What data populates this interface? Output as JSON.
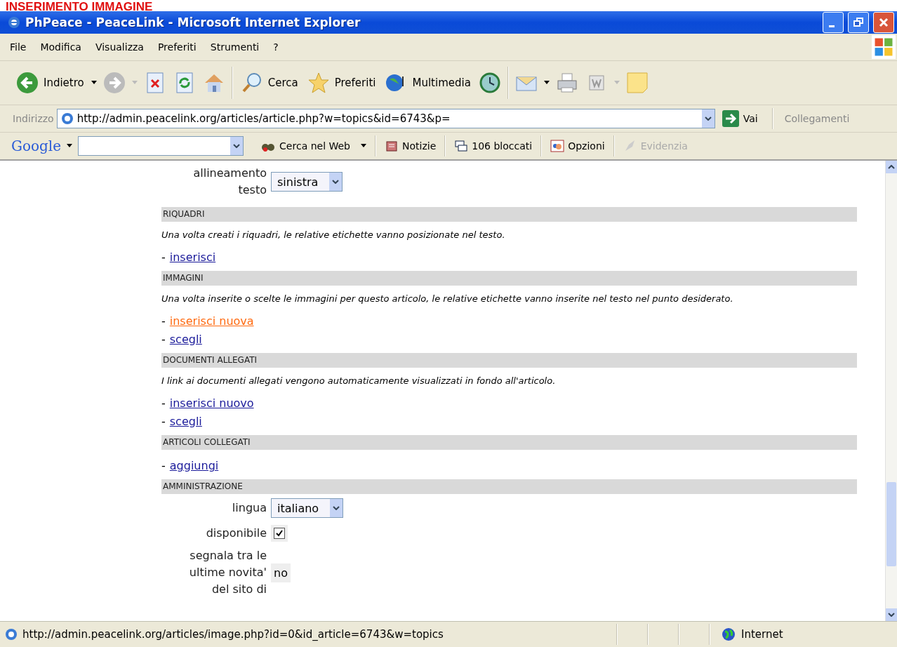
{
  "caption": "INSERIMENTO IMMAGINE",
  "window": {
    "title": "PhPeace - PeaceLink - Microsoft Internet Explorer"
  },
  "menu": [
    "File",
    "Modifica",
    "Visualizza",
    "Preferiti",
    "Strumenti",
    "?"
  ],
  "toolbar": {
    "back": "Indietro",
    "search": "Cerca",
    "favorites": "Preferiti",
    "media": "Multimedia"
  },
  "address": {
    "label": "Indirizzo",
    "value": "http://admin.peacelink.org/articles/article.php?w=topics&id=6743&p=",
    "go": "Vai",
    "links": "Collegamenti"
  },
  "google_bar": {
    "logo": "Google",
    "items": [
      {
        "kind": "search",
        "label": "Cerca nel Web",
        "disabled": false
      },
      {
        "kind": "news",
        "label": "Notizie",
        "disabled": false
      },
      {
        "kind": "blocked",
        "label": "106 bloccati",
        "disabled": false
      },
      {
        "kind": "options",
        "label": "Opzioni",
        "disabled": false
      },
      {
        "kind": "highlight",
        "label": "Evidenzia",
        "disabled": true
      }
    ]
  },
  "content": [
    {
      "kind": "select",
      "label": "allineamento testo",
      "value": "sinistra"
    },
    {
      "kind": "header",
      "label": "RIQUADRI"
    },
    {
      "kind": "note",
      "text": "Una volta creati i riquadri, le relative etichette vanno posizionate nel testo."
    },
    {
      "kind": "link",
      "prefix": "-",
      "label": "inserisci",
      "active": false
    },
    {
      "kind": "header",
      "label": "IMMAGINI"
    },
    {
      "kind": "note",
      "text": "Una volta inserite o scelte le immagini per questo articolo, le relative etichette vanno inserite nel testo nel punto desiderato."
    },
    {
      "kind": "link",
      "prefix": "-",
      "label": "inserisci nuova",
      "active": true
    },
    {
      "kind": "link",
      "prefix": "-",
      "label": "scegli",
      "active": false
    },
    {
      "kind": "header",
      "label": "DOCUMENTI ALLEGATI"
    },
    {
      "kind": "note",
      "text": "I link ai documenti allegati vengono automaticamente visualizzati in fondo all'articolo."
    },
    {
      "kind": "link",
      "prefix": "-",
      "label": "inserisci nuovo",
      "active": false
    },
    {
      "kind": "link",
      "prefix": "-",
      "label": "scegli",
      "active": false
    },
    {
      "kind": "header",
      "label": "ARTICOLI COLLEGATI"
    },
    {
      "kind": "link",
      "prefix": "-",
      "label": "aggiungi",
      "active": false
    },
    {
      "kind": "header",
      "label": "AMMINISTRAZIONE"
    },
    {
      "kind": "select",
      "label": "lingua",
      "value": "italiano"
    },
    {
      "kind": "checkbox",
      "label": "disponibile",
      "checked": true
    },
    {
      "kind": "static",
      "label": "segnala tra le ultime novita' del sito di",
      "value": "no"
    }
  ],
  "status_bar": {
    "url": "http://admin.peacelink.org/articles/image.php?id=0&id_article=6743&w=topics",
    "zone": "Internet"
  }
}
